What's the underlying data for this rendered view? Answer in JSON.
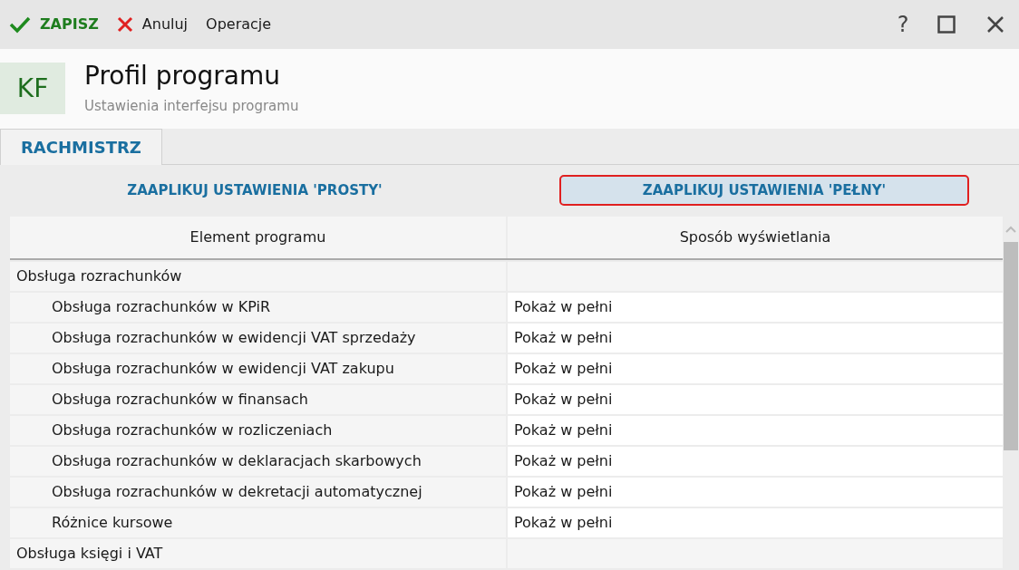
{
  "toolbar": {
    "save": "ZAPISZ",
    "cancel": "Anuluj",
    "operations": "Operacje",
    "help": "?"
  },
  "header": {
    "badge": "KF",
    "title": "Profil programu",
    "subtitle": "Ustawienia interfejsu programu"
  },
  "tabs": [
    {
      "label": "RACHMISTRZ",
      "selected": true
    }
  ],
  "apply_buttons": [
    {
      "label": "ZAAPLIKUJ USTAWIENIA 'PROSTY'",
      "selected": false
    },
    {
      "label": "ZAAPLIKUJ USTAWIENIA 'PEŁNY'",
      "selected": true
    }
  ],
  "table": {
    "columns": [
      "Element programu",
      "Sposób wyświetlania"
    ],
    "rows": [
      {
        "name": "Obsługa rozrachunków",
        "children": [
          {
            "name": "Obsługa rozrachunków w KPiR",
            "value": "Pokaż w pełni"
          },
          {
            "name": "Obsługa rozrachunków w ewidencji VAT sprzedaży",
            "value": "Pokaż w pełni"
          },
          {
            "name": "Obsługa rozrachunków w ewidencji VAT zakupu",
            "value": "Pokaż w pełni"
          },
          {
            "name": "Obsługa rozrachunków w finansach",
            "value": "Pokaż w pełni"
          },
          {
            "name": "Obsługa rozrachunków w rozliczeniach",
            "value": "Pokaż w pełni"
          },
          {
            "name": "Obsługa rozrachunków w deklaracjach skarbowych",
            "value": "Pokaż w pełni"
          },
          {
            "name": "Obsługa rozrachunków w dekretacji automatycznej",
            "value": "Pokaż w pełni"
          },
          {
            "name": "Różnice kursowe",
            "value": "Pokaż w pełni"
          }
        ]
      },
      {
        "name": "Obsługa księgi i VAT",
        "children": []
      }
    ]
  }
}
